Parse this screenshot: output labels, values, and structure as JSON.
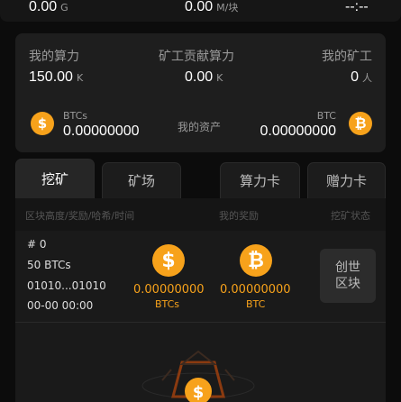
{
  "top_row": {
    "left_value": "0.00",
    "left_unit": "G",
    "mid_value": "0.00",
    "mid_unit": "M/块",
    "right_value": "--:--"
  },
  "stats": {
    "my_power_label": "我的算力",
    "my_power_value": "150.00",
    "my_power_unit": "K",
    "contrib_label": "矿工贡献算力",
    "contrib_value": "0.00",
    "contrib_unit": "K",
    "miners_label": "我的矿工",
    "miners_value": "0",
    "miners_unit": "人"
  },
  "assets": {
    "label": "我的资产",
    "left_name": "BTCs",
    "left_value": "0.00000000",
    "right_name": "BTC",
    "right_value": "0.00000000"
  },
  "tabs": [
    "挖矿",
    "矿场",
    "算力卡",
    "赠力卡"
  ],
  "table_header": {
    "col1": "区块高度/奖励/哈希/时间",
    "col2": "我的奖励",
    "col3": "挖矿状态"
  },
  "block": {
    "height": "# 0",
    "reward": "50 BTCs",
    "hash": "01010...01010",
    "time": "00-00 00:00",
    "btcs_value": "0.00000000",
    "btcs_name": "BTCs",
    "btc_value": "0.00000000",
    "btc_name": "BTC",
    "status": "创世区块"
  },
  "colors": {
    "accent": "#f7a21b",
    "card": "#1e1e1e",
    "bg": "#0c0c0c"
  },
  "icons": [
    "dollar-coin-icon",
    "bitcoin-coin-icon",
    "mining-machine-icon"
  ]
}
